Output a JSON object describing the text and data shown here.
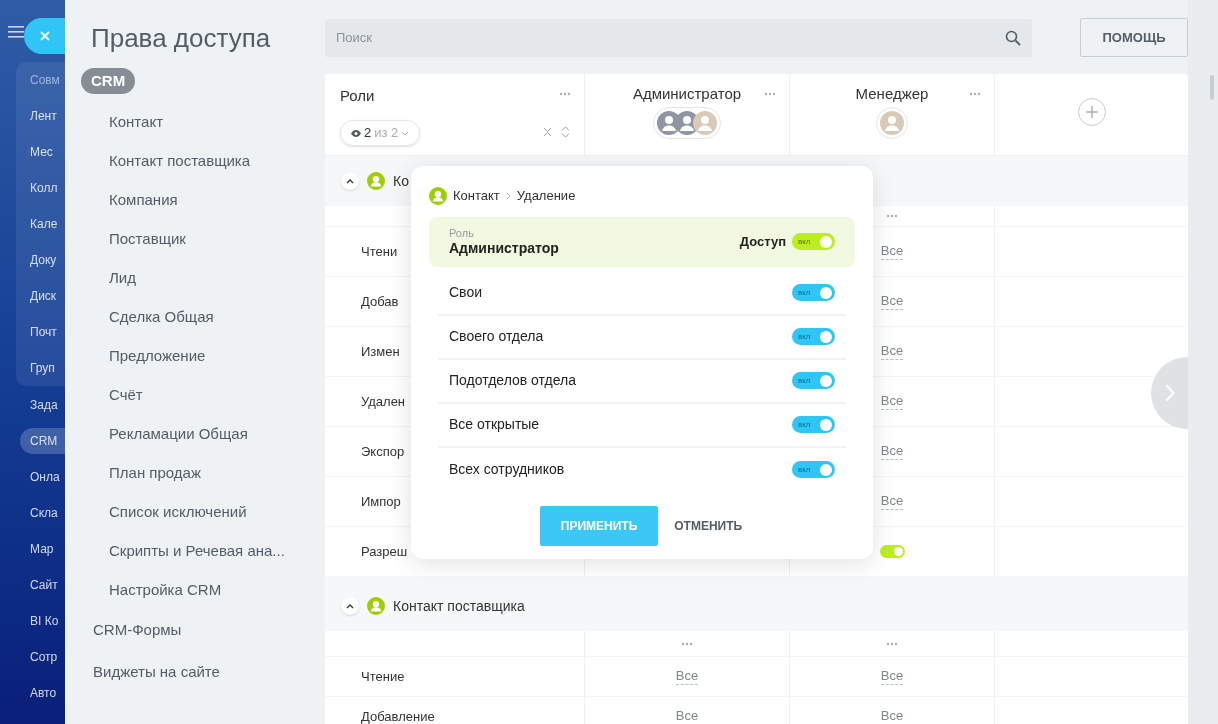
{
  "left_menu": {
    "group": {
      "title": "Совм",
      "items": [
        {
          "label": "Лент",
          "selected": false
        },
        {
          "label": "Мес",
          "selected": false
        },
        {
          "label": "Колл",
          "selected": false
        },
        {
          "label": "Кале",
          "selected": false
        },
        {
          "label": "Доку",
          "selected": false
        },
        {
          "label": "Диск",
          "selected": false
        },
        {
          "label": "Почт",
          "selected": false
        },
        {
          "label": "Груп",
          "selected": false
        }
      ]
    },
    "items": [
      {
        "label": "Зада",
        "selected": false
      },
      {
        "label": "CRM",
        "selected": true
      },
      {
        "label": "Онла",
        "selected": false
      },
      {
        "label": "Скла",
        "selected": false
      },
      {
        "label": "Мар",
        "selected": false
      },
      {
        "label": "Сайт",
        "selected": false
      },
      {
        "label": "BI Ко",
        "selected": false
      },
      {
        "label": "Сотр",
        "selected": false
      },
      {
        "label": "Авто",
        "selected": false
      }
    ]
  },
  "panel": {
    "title": "Права доступа",
    "nav": [
      {
        "label": "CRM",
        "selected": true,
        "children": [
          {
            "label": "Контакт",
            "selected": false
          },
          {
            "label": "Контакт поставщика",
            "selected": false
          },
          {
            "label": "Компания",
            "selected": false
          },
          {
            "label": "Поставщик",
            "selected": false
          },
          {
            "label": "Лид",
            "selected": false
          },
          {
            "label": "Сделка Общая",
            "selected": false
          },
          {
            "label": "Предложение",
            "selected": false
          },
          {
            "label": "Счёт",
            "selected": false
          },
          {
            "label": "Рекламации Общая",
            "selected": false
          },
          {
            "label": "План продаж",
            "selected": false
          },
          {
            "label": "Список исключений",
            "selected": false
          },
          {
            "label": "Скрипты и Речевая ана...",
            "selected": false
          },
          {
            "label": "Настройка CRM",
            "selected": false
          }
        ]
      },
      {
        "label": "CRM-Формы",
        "selected": false
      },
      {
        "label": "Виджеты на сайте",
        "selected": false
      }
    ]
  },
  "search": {
    "placeholder": "Поиск"
  },
  "help_button": "ПОМОЩЬ",
  "table": {
    "roles_title": "Роли",
    "filter": {
      "shown": "2",
      "total": "из 2"
    },
    "columns": [
      {
        "title": "Администратор",
        "avatars": [
          {
            "kind": "silhouette"
          },
          {
            "kind": "silhouette"
          },
          {
            "kind": "photo"
          }
        ]
      },
      {
        "title": "Менеджер",
        "avatars": [
          {
            "kind": "photo"
          }
        ]
      }
    ],
    "sections": [
      {
        "title": "Ко",
        "expanded": true,
        "rows": [
          {
            "label": "Чтени",
            "manager_cell": {
              "kind": "value",
              "text": "Все"
            }
          },
          {
            "label": "Добав",
            "manager_cell": {
              "kind": "value",
              "text": "Все"
            }
          },
          {
            "label": "Измен",
            "manager_cell": {
              "kind": "value",
              "text": "Все"
            }
          },
          {
            "label": "Удален",
            "manager_cell": {
              "kind": "value",
              "text": "Все"
            }
          },
          {
            "label": "Экспор",
            "manager_cell": {
              "kind": "value",
              "text": "Все"
            }
          },
          {
            "label": "Импор",
            "manager_cell": {
              "kind": "value",
              "text": "Все"
            }
          },
          {
            "label": "Разреш",
            "manager_cell": {
              "kind": "toggle",
              "on": true
            }
          }
        ]
      },
      {
        "title": "Контакт поставщика",
        "expanded": true,
        "rows": [
          {
            "label": "Чтение",
            "admin_cell": {
              "kind": "value",
              "text": "Все"
            },
            "manager_cell": {
              "kind": "value",
              "text": "Все"
            }
          },
          {
            "label": "Добавление",
            "admin_cell": {
              "kind": "value",
              "text": "Все"
            },
            "manager_cell": {
              "kind": "value",
              "text": "Все"
            }
          }
        ]
      }
    ]
  },
  "popup": {
    "breadcrumb": [
      "Контакт",
      "Удаление"
    ],
    "role": {
      "caption": "Роль",
      "name": "Администратор",
      "access_label": "Доступ",
      "on": true,
      "toggle_text": "вкл"
    },
    "options": [
      {
        "label": "Свои",
        "on": true,
        "toggle_text": "вкл"
      },
      {
        "label": "Своего отдела",
        "on": true,
        "toggle_text": "вкл"
      },
      {
        "label": "Подотделов отдела",
        "on": true,
        "toggle_text": "вкл"
      },
      {
        "label": "Все открытые",
        "on": true,
        "toggle_text": "вкл"
      },
      {
        "label": "Всех сотрудников",
        "on": true,
        "toggle_text": "вкл"
      }
    ],
    "apply": "ПРИМЕНИТЬ",
    "cancel": "ОТМЕНИТЬ"
  }
}
